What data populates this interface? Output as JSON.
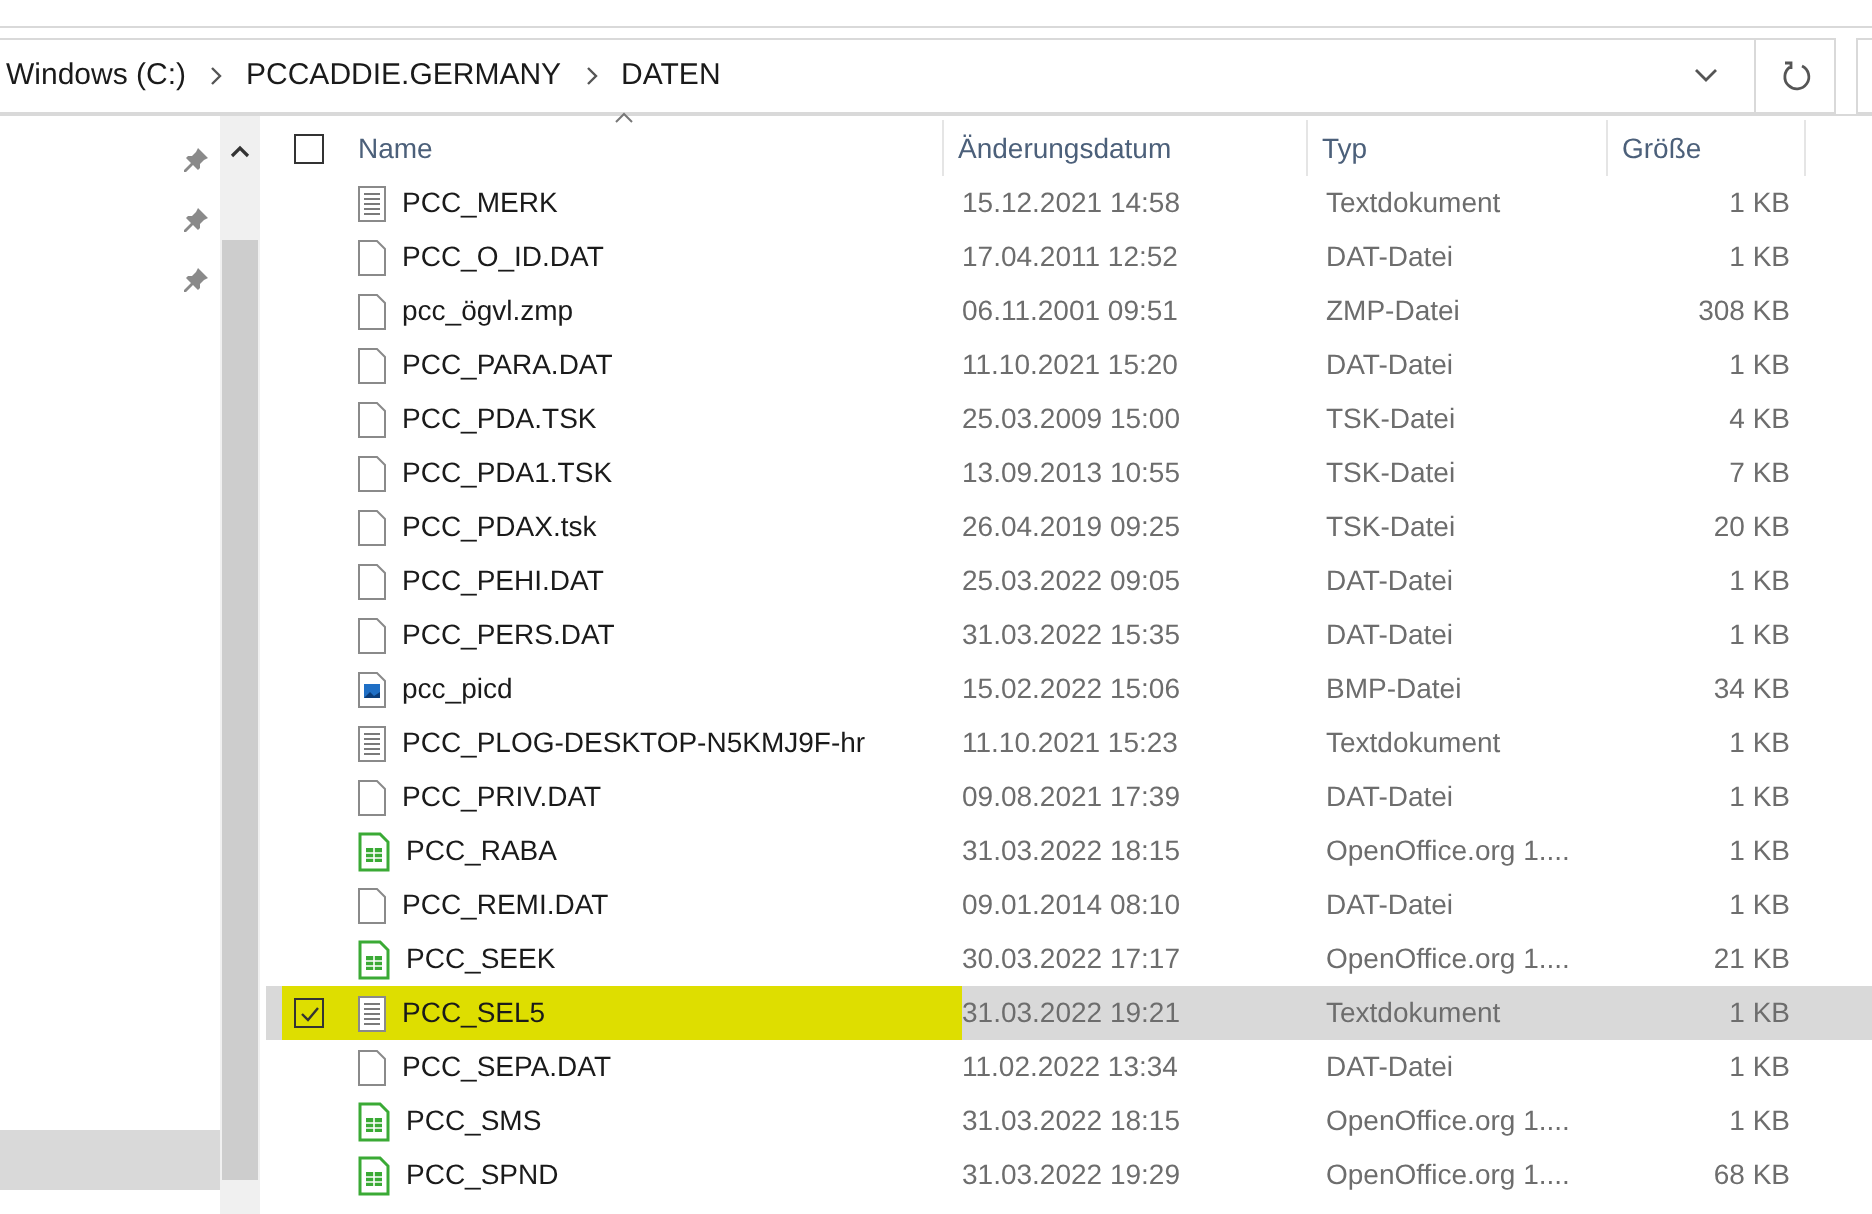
{
  "breadcrumbs": [
    "Windows (C:)",
    "PCCADDIE.GERMANY",
    "DATEN"
  ],
  "columns": [
    "Name",
    "Änderungsdatum",
    "Typ",
    "Größe"
  ],
  "all_checked": false,
  "files": [
    {
      "name": "PCC_MERK",
      "date": "15.12.2021 14:58",
      "type": "Textdokument",
      "size": "1 KB",
      "kind": "text",
      "selected": false,
      "checked": false,
      "highlighted": false
    },
    {
      "name": "PCC_O_ID.DAT",
      "date": "17.04.2011 12:52",
      "type": "DAT-Datei",
      "size": "1 KB",
      "kind": "blank",
      "selected": false,
      "checked": false,
      "highlighted": false
    },
    {
      "name": "pcc_ögvl.zmp",
      "date": "06.11.2001 09:51",
      "type": "ZMP-Datei",
      "size": "308 KB",
      "kind": "blank",
      "selected": false,
      "checked": false,
      "highlighted": false
    },
    {
      "name": "PCC_PARA.DAT",
      "date": "11.10.2021 15:20",
      "type": "DAT-Datei",
      "size": "1 KB",
      "kind": "blank",
      "selected": false,
      "checked": false,
      "highlighted": false
    },
    {
      "name": "PCC_PDA.TSK",
      "date": "25.03.2009 15:00",
      "type": "TSK-Datei",
      "size": "4 KB",
      "kind": "blank",
      "selected": false,
      "checked": false,
      "highlighted": false
    },
    {
      "name": "PCC_PDA1.TSK",
      "date": "13.09.2013 10:55",
      "type": "TSK-Datei",
      "size": "7 KB",
      "kind": "blank",
      "selected": false,
      "checked": false,
      "highlighted": false
    },
    {
      "name": "PCC_PDAX.tsk",
      "date": "26.04.2019 09:25",
      "type": "TSK-Datei",
      "size": "20 KB",
      "kind": "blank",
      "selected": false,
      "checked": false,
      "highlighted": false
    },
    {
      "name": "PCC_PEHI.DAT",
      "date": "25.03.2022 09:05",
      "type": "DAT-Datei",
      "size": "1 KB",
      "kind": "blank",
      "selected": false,
      "checked": false,
      "highlighted": false
    },
    {
      "name": "PCC_PERS.DAT",
      "date": "31.03.2022 15:35",
      "type": "DAT-Datei",
      "size": "1 KB",
      "kind": "blank",
      "selected": false,
      "checked": false,
      "highlighted": false
    },
    {
      "name": "pcc_picd",
      "date": "15.02.2022 15:06",
      "type": "BMP-Datei",
      "size": "34 KB",
      "kind": "image",
      "selected": false,
      "checked": false,
      "highlighted": false
    },
    {
      "name": "PCC_PLOG-DESKTOP-N5KMJ9F-hr",
      "date": "11.10.2021 15:23",
      "type": "Textdokument",
      "size": "1 KB",
      "kind": "text",
      "selected": false,
      "checked": false,
      "highlighted": false
    },
    {
      "name": "PCC_PRIV.DAT",
      "date": "09.08.2021 17:39",
      "type": "DAT-Datei",
      "size": "1 KB",
      "kind": "blank",
      "selected": false,
      "checked": false,
      "highlighted": false
    },
    {
      "name": "PCC_RABA",
      "date": "31.03.2022 18:15",
      "type": "OpenOffice.org 1....",
      "size": "1 KB",
      "kind": "sheet",
      "selected": false,
      "checked": false,
      "highlighted": false
    },
    {
      "name": "PCC_REMI.DAT",
      "date": "09.01.2014 08:10",
      "type": "DAT-Datei",
      "size": "1 KB",
      "kind": "blank",
      "selected": false,
      "checked": false,
      "highlighted": false
    },
    {
      "name": "PCC_SEEK",
      "date": "30.03.2022 17:17",
      "type": "OpenOffice.org 1....",
      "size": "21 KB",
      "kind": "sheet",
      "selected": false,
      "checked": false,
      "highlighted": false
    },
    {
      "name": "PCC_SEL5",
      "date": "31.03.2022 19:21",
      "type": "Textdokument",
      "size": "1 KB",
      "kind": "text",
      "selected": true,
      "checked": true,
      "highlighted": true
    },
    {
      "name": "PCC_SEPA.DAT",
      "date": "11.02.2022 13:34",
      "type": "DAT-Datei",
      "size": "1 KB",
      "kind": "blank",
      "selected": false,
      "checked": false,
      "highlighted": false
    },
    {
      "name": "PCC_SMS",
      "date": "31.03.2022 18:15",
      "type": "OpenOffice.org 1....",
      "size": "1 KB",
      "kind": "sheet",
      "selected": false,
      "checked": false,
      "highlighted": false
    },
    {
      "name": "PCC_SPND",
      "date": "31.03.2022 19:29",
      "type": "OpenOffice.org 1....",
      "size": "68 KB",
      "kind": "sheet",
      "selected": false,
      "checked": false,
      "highlighted": false
    }
  ]
}
